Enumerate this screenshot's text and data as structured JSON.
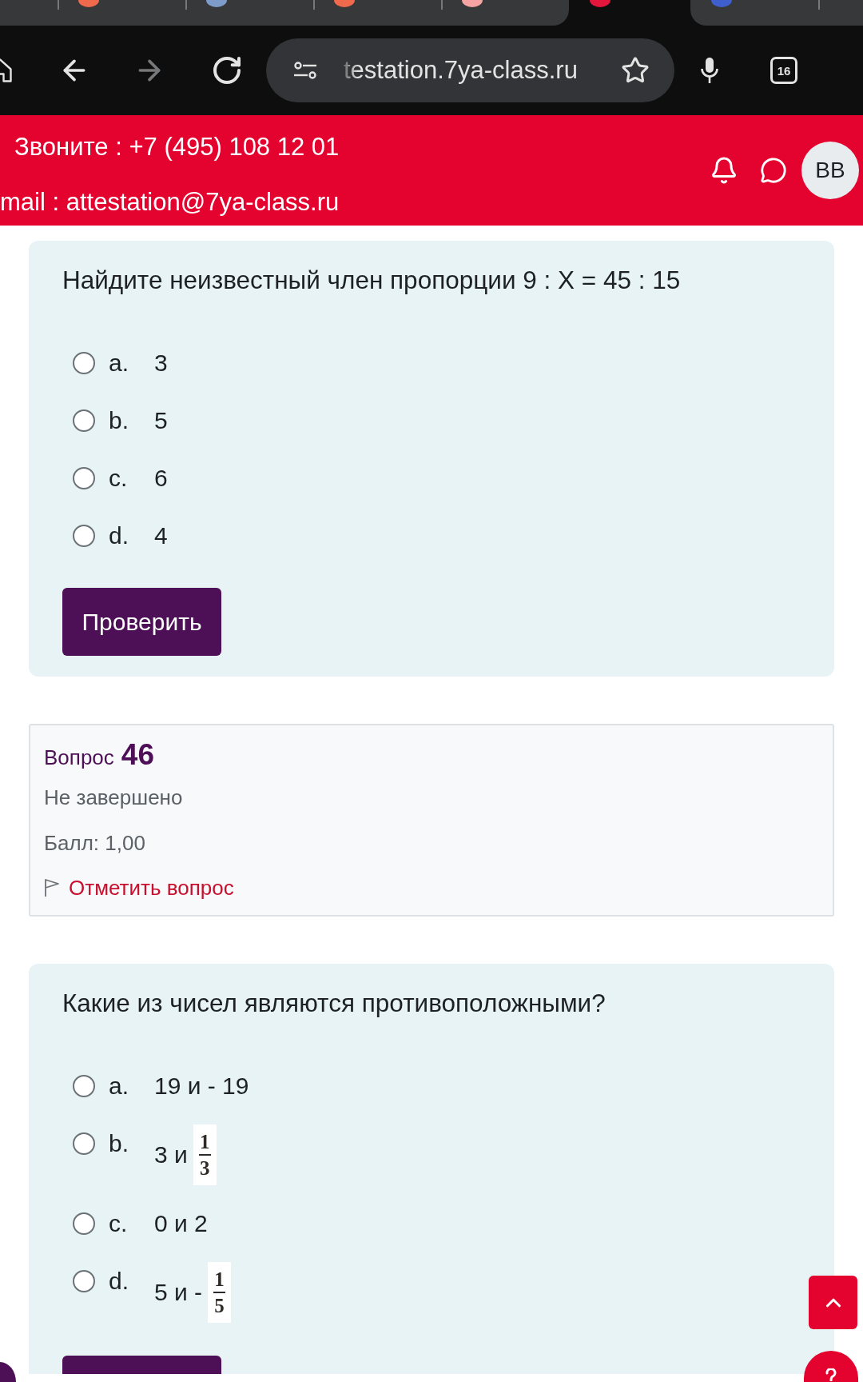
{
  "browser_tabs": [
    {
      "selected": false
    },
    {
      "selected": false,
      "color": "#ef6a4c"
    },
    {
      "selected": false,
      "color": "#7e9cc9"
    },
    {
      "selected": false,
      "color": "#ef6a4c"
    },
    {
      "selected": false,
      "color": "#f6a3a3"
    },
    {
      "selected": true,
      "color": "#e3163b"
    },
    {
      "selected": false,
      "color": "#3f5fcf"
    },
    {
      "selected": false
    }
  ],
  "address_bar": {
    "url": "testation.7ya-class.ru"
  },
  "tab_switcher": {
    "count": "16"
  },
  "site_header": {
    "phone": "Звоните : +7 (495) 108 12 01",
    "email": "mail : attestation@7ya-class.ru",
    "avatar": "BB"
  },
  "blocks": [
    {
      "kind": "question",
      "text": "Найдите неизвестный член пропорции 9 : X = 45 : 15",
      "options": [
        {
          "letter": "a.",
          "value": "3",
          "selected": false
        },
        {
          "letter": "b.",
          "value": "5",
          "selected": false
        },
        {
          "letter": "c.",
          "value": "6",
          "selected": false
        },
        {
          "letter": "d.",
          "value": "4",
          "selected": false
        }
      ],
      "button": "Проверить"
    },
    {
      "kind": "info",
      "label": "Вопрос",
      "number": "46",
      "status": "Не завершено",
      "score": "Балл: 1,00",
      "flag_link": "Отметить вопрос"
    },
    {
      "kind": "question",
      "text": "Какие из чисел являются противоположными?",
      "options": [
        {
          "letter": "a.",
          "value": "19 и - 19",
          "selected": false
        },
        {
          "letter": "b.",
          "value": "3 и",
          "fraction": {
            "numerator": "1",
            "denominator": "3"
          },
          "selected": false
        },
        {
          "letter": "c.",
          "value": "0 и 2",
          "selected": false
        },
        {
          "letter": "d.",
          "value": "5 и -",
          "fraction": {
            "numerator": "1",
            "denominator": "5"
          },
          "selected": false
        }
      ],
      "has_button": true
    }
  ],
  "floating_buttons": [
    {
      "kind": "scroll_top"
    },
    {
      "kind": "drawer"
    },
    {
      "kind": "help"
    }
  ]
}
